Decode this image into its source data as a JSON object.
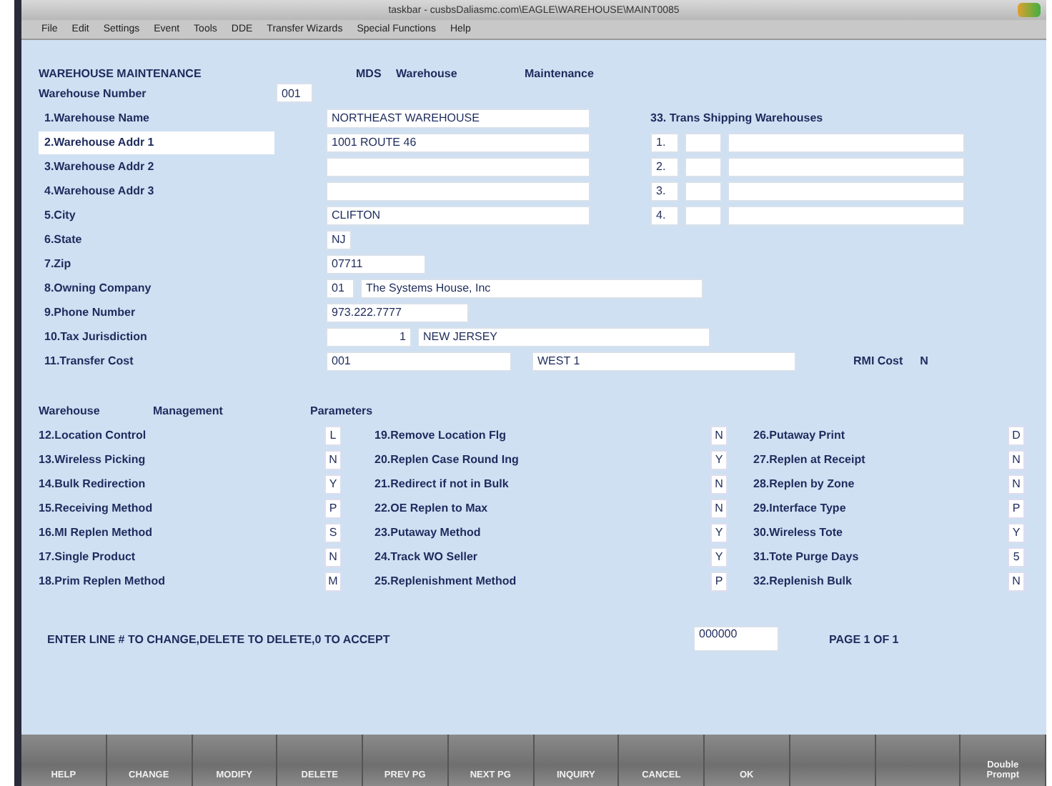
{
  "window": {
    "title": "taskbar - cusbsDaliasmc.com\\EAGLE\\WAREHOUSE\\MAINT0085"
  },
  "menu": [
    "File",
    "Edit",
    "Settings",
    "Event",
    "Tools",
    "DDE",
    "Transfer Wizards",
    "Special Functions",
    "Help"
  ],
  "header": {
    "title": "WAREHOUSE MAINTENANCE",
    "module": "MDS",
    "subject": "Warehouse",
    "action": "Maintenance"
  },
  "warehouse_number": {
    "label": "Warehouse Number",
    "value": "001"
  },
  "fields": [
    {
      "label": "1.Warehouse Name",
      "highlighted": false,
      "values": [
        "NORTHEAST WAREHOUSE"
      ]
    },
    {
      "label": "2.Warehouse Addr 1",
      "highlighted": true,
      "values": [
        "1001 ROUTE 46"
      ]
    },
    {
      "label": "3.Warehouse Addr 2",
      "highlighted": false
    },
    {
      "label": "4.Warehouse Addr 3",
      "highlighted": false
    },
    {
      "label": "5.City",
      "highlighted": false,
      "values": [
        "CLIFTON"
      ]
    },
    {
      "label": "6.State",
      "highlighted": false,
      "values": [
        "NJ"
      ]
    },
    {
      "label": "7.Zip",
      "highlighted": false,
      "values": [
        "07711"
      ]
    },
    {
      "label": "8.Owning Company",
      "highlighted": false,
      "values": [
        "01",
        "The Systems House, Inc"
      ]
    },
    {
      "label": "9.Phone Number",
      "highlighted": false,
      "values": [
        "973.222.7777"
      ]
    },
    {
      "label": "10.Tax Jurisdiction",
      "highlighted": false,
      "values": [
        "1",
        "NEW JERSEY"
      ]
    },
    {
      "label": "11.Transfer Cost",
      "highlighted": false,
      "values": [
        "001",
        "WEST 1"
      ]
    }
  ],
  "rmi_cost": {
    "label": "RMI Cost",
    "value": "N"
  },
  "trans_shipping": {
    "title": "33. Trans Shipping Warehouses",
    "rows": [
      "1.",
      "2.",
      "3.",
      "4."
    ]
  },
  "parameters": {
    "headings": [
      "Warehouse",
      "Management",
      "Parameters"
    ],
    "columns": [
      [
        {
          "label": "12.Location Control",
          "value": "L"
        },
        {
          "label": "13.Wireless Picking",
          "value": "N"
        },
        {
          "label": "14.Bulk Redirection",
          "value": "Y"
        },
        {
          "label": "15.Receiving Method",
          "value": "P"
        },
        {
          "label": "16.MI Replen Method",
          "value": "S"
        },
        {
          "label": "17.Single Product",
          "value": "N"
        },
        {
          "label": "18.Prim Replen Method",
          "value": "M"
        }
      ],
      [
        {
          "label": "19.Remove Location Flg",
          "value": "N"
        },
        {
          "label": "20.Replen Case Round Ing",
          "value": "Y"
        },
        {
          "label": "21.Redirect if not in Bulk",
          "value": "N"
        },
        {
          "label": "22.OE Replen to Max",
          "value": "N"
        },
        {
          "label": "23.Putaway Method",
          "value": "Y"
        },
        {
          "label": "24.Track WO Seller",
          "value": "Y"
        },
        {
          "label": "25.Replenishment Method",
          "value": "P"
        }
      ],
      [
        {
          "label": "26.Putaway Print",
          "value": "D"
        },
        {
          "label": "27.Replen at Receipt",
          "value": "N"
        },
        {
          "label": "28.Replen by Zone",
          "value": "N"
        },
        {
          "label": "29.Interface Type",
          "value": "P"
        },
        {
          "label": "30.Wireless Tote",
          "value": "Y"
        },
        {
          "label": "31.Tote Purge Days",
          "value": "5"
        },
        {
          "label": "32.Replenish Bulk",
          "value": "N"
        }
      ]
    ]
  },
  "prompt": {
    "text": "ENTER LINE # TO CHANGE,DELETE TO DELETE,0 TO ACCEPT",
    "value": "000000",
    "page": "PAGE 1 OF 1"
  },
  "function_keys": [
    {
      "kind": "key",
      "lines": [
        "HELP"
      ]
    },
    {
      "kind": "key",
      "lines": [
        "CHANGE"
      ]
    },
    {
      "kind": "key",
      "lines": [
        "MODIFY"
      ]
    },
    {
      "kind": "key",
      "lines": [
        "DELETE"
      ]
    },
    {
      "kind": "key",
      "lines": [
        "PREV PG"
      ]
    },
    {
      "kind": "key",
      "lines": [
        "NEXT PG"
      ]
    },
    {
      "kind": "key",
      "lines": [
        "INQUIRY"
      ]
    },
    {
      "kind": "key",
      "lines": [
        "CANCEL"
      ]
    },
    {
      "kind": "key",
      "lines": [
        "OK"
      ]
    },
    {
      "kind": "blank"
    },
    {
      "kind": "blank"
    },
    {
      "kind": "key",
      "lines": [
        "Double",
        "Prompt"
      ]
    }
  ]
}
